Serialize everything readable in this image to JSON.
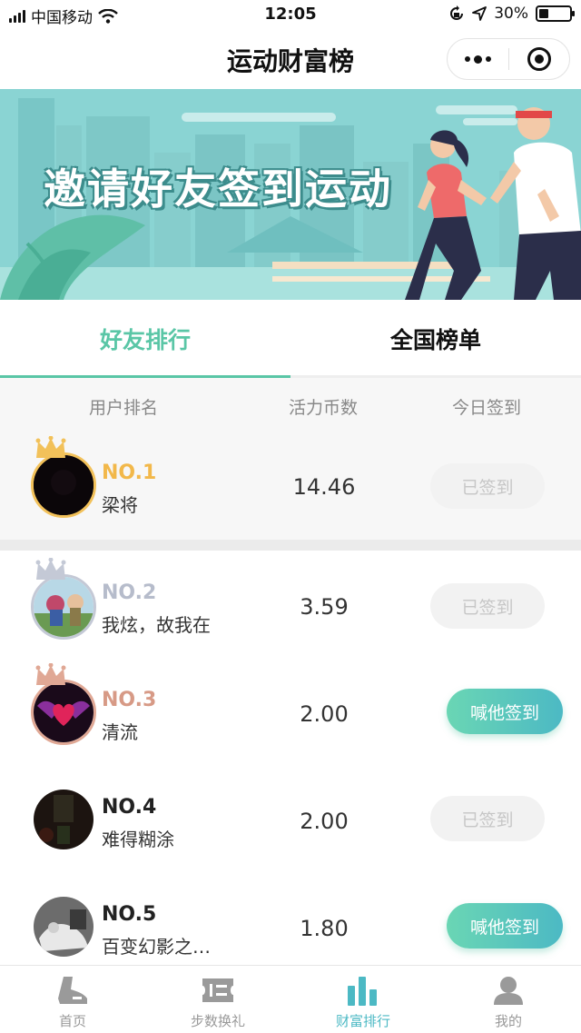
{
  "status_bar": {
    "carrier": "中国移动",
    "time": "12:05",
    "battery": "30%",
    "battery_level": 0.3
  },
  "nav": {
    "title": "运动财富榜"
  },
  "banner": {
    "text": "邀请好友签到运动"
  },
  "tabs": [
    {
      "label": "好友排行",
      "active": true
    },
    {
      "label": "全国榜单",
      "active": false
    }
  ],
  "table_header": {
    "rank": "用户排名",
    "coins": "活力币数",
    "signin": "今日签到"
  },
  "rows": [
    {
      "rank": "NO.1",
      "name": "梁将",
      "coins": "14.46",
      "action": "已签到",
      "signed": true
    },
    {
      "rank": "NO.2",
      "name": "我炫，故我在",
      "coins": "3.59",
      "action": "已签到",
      "signed": true
    },
    {
      "rank": "NO.3",
      "name": "清流",
      "coins": "2.00",
      "action": "喊他签到",
      "signed": false
    },
    {
      "rank": "NO.4",
      "name": "难得糊涂",
      "coins": "2.00",
      "action": "已签到",
      "signed": true
    },
    {
      "rank": "NO.5",
      "name": "百变幻影之…",
      "coins": "1.80",
      "action": "喊他签到",
      "signed": false
    }
  ],
  "colors": {
    "accent": "#5ac6a6",
    "gold": "#f2b84a",
    "silver": "#b6bccb",
    "bronze": "#d79a86"
  },
  "tabbar": [
    {
      "label": "首页",
      "icon": "shoe-icon",
      "active": false
    },
    {
      "label": "步数换礼",
      "icon": "ticket-icon",
      "active": false
    },
    {
      "label": "财富排行",
      "icon": "bar-chart-icon",
      "active": true
    },
    {
      "label": "我的",
      "icon": "user-icon",
      "active": false
    }
  ]
}
